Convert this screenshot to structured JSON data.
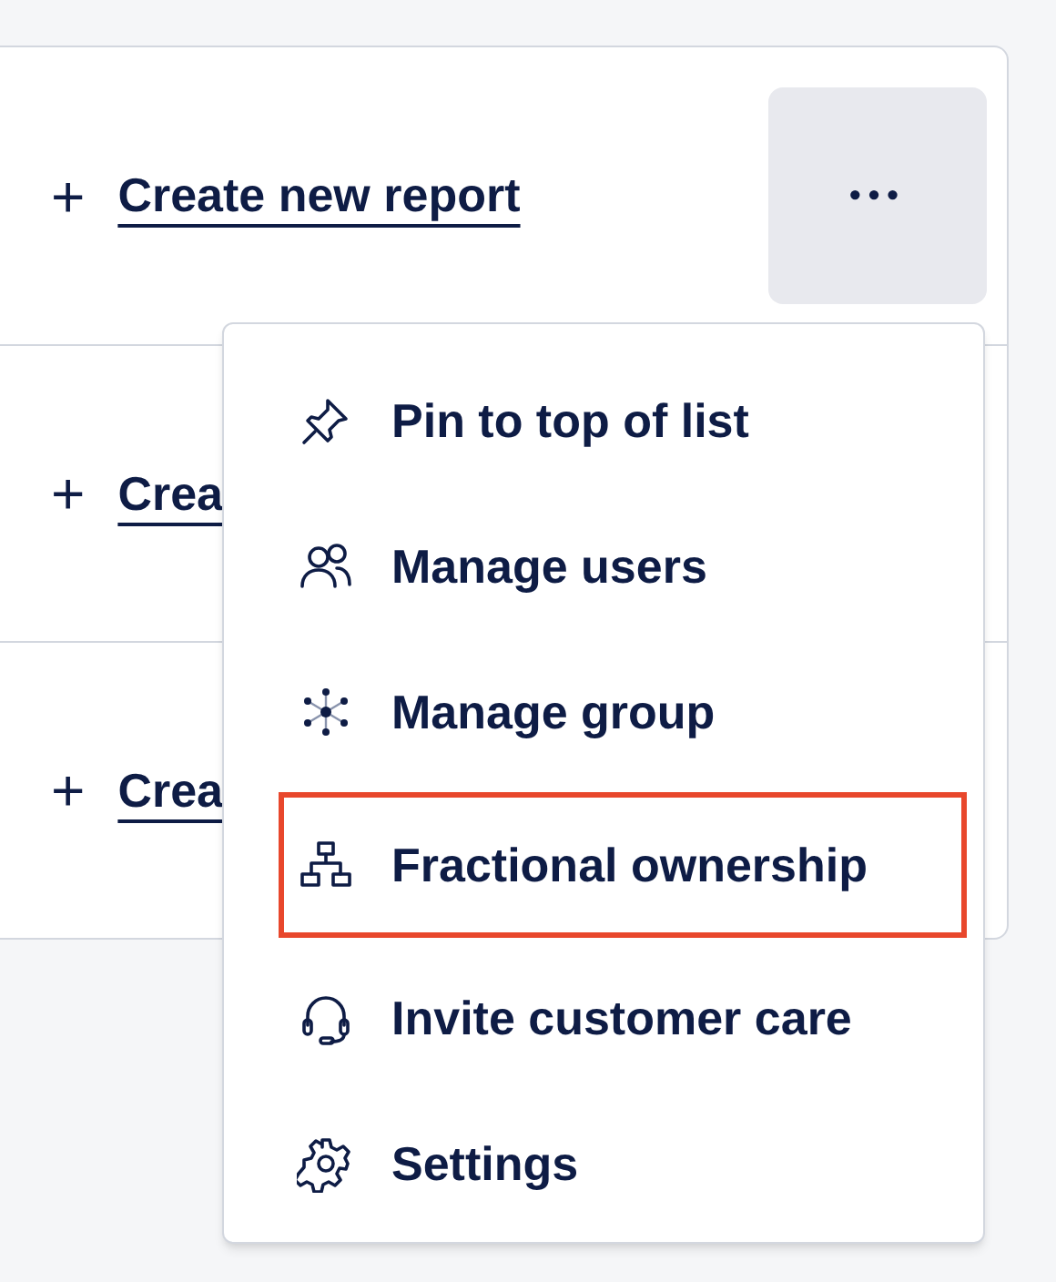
{
  "rows": [
    {
      "icon": "+",
      "label": "Create new report",
      "more": "•••"
    },
    {
      "icon": "+",
      "label": "Crea"
    },
    {
      "icon": "+",
      "label": "Crea"
    }
  ],
  "menu": {
    "items": [
      {
        "kind": "pin",
        "label": "Pin to top of list",
        "highlighted": false
      },
      {
        "kind": "users",
        "label": "Manage users",
        "highlighted": false
      },
      {
        "kind": "group",
        "label": "Manage group",
        "highlighted": false
      },
      {
        "kind": "hierarchy",
        "label": "Fractional ownership",
        "highlighted": true
      },
      {
        "kind": "headset",
        "label": "Invite customer care",
        "highlighted": false
      },
      {
        "kind": "gear",
        "label": "Settings",
        "highlighted": false
      }
    ]
  }
}
